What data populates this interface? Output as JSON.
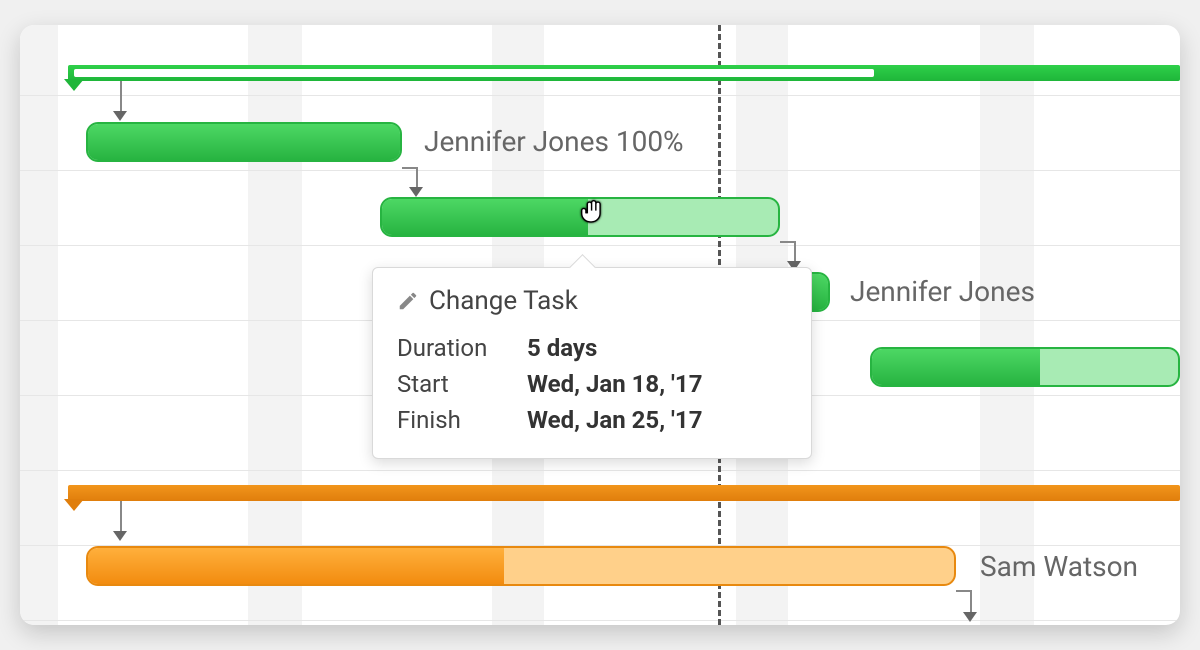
{
  "gantt": {
    "summary_green": {
      "progress_pct": 75
    },
    "summary_orange": {},
    "tasks": {
      "t1": {
        "assignee": "Jennifer Jones",
        "progress_pct": 100
      },
      "t2": {
        "assignee": "Jennifer Jones",
        "progress_pct": 50
      },
      "t3": {
        "assignee": "Jennifer Jones",
        "progress_pct": 60
      },
      "t4": {
        "assignee": "Sam Watson",
        "progress_pct": 50
      }
    },
    "label_t1": "Jennifer Jones  100%",
    "label_t3": "Jennifer Jones",
    "label_t4": "Sam Watson"
  },
  "popover": {
    "title": "Change Task",
    "duration_label": "Duration",
    "duration_value": "5 days",
    "start_label": "Start",
    "start_value": "Wed, Jan 18, '17",
    "finish_label": "Finish",
    "finish_value": "Wed, Jan 25, '17"
  },
  "colors": {
    "green": "#27B441",
    "orange": "#F28C0F"
  }
}
